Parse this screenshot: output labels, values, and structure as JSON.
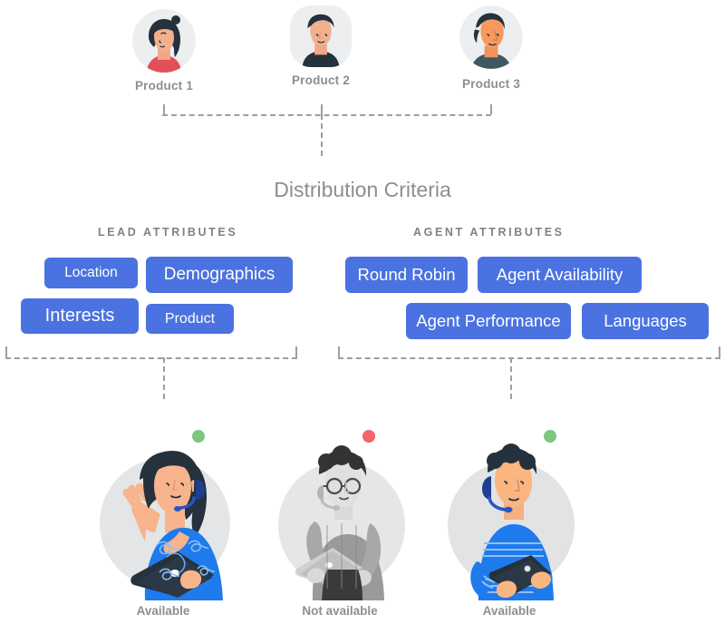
{
  "diagram": {
    "title": "Distribution Criteria",
    "products": [
      {
        "label": "Product 1",
        "avatar": "avatar-woman-red-top"
      },
      {
        "label": "Product 2",
        "avatar": "avatar-man-dark-top"
      },
      {
        "label": "Product 3",
        "avatar": "avatar-man-teal-top"
      }
    ],
    "groups": [
      {
        "heading": "LEAD ATTRIBUTES",
        "chips": [
          {
            "label": "Location"
          },
          {
            "label": "Demographics"
          },
          {
            "label": "Interests"
          },
          {
            "label": "Product"
          }
        ]
      },
      {
        "heading": "AGENT ATTRIBUTES",
        "chips": [
          {
            "label": "Round Robin"
          },
          {
            "label": "Agent Availability"
          },
          {
            "label": "Agent Performance"
          },
          {
            "label": "Languages"
          }
        ]
      }
    ],
    "agents": [
      {
        "label": "Available",
        "status": "available",
        "status_color": "#7dc67f",
        "illustration": "agent-woman-laptop-waving"
      },
      {
        "label": "Not available",
        "status": "not-available",
        "status_color": "#f4646b",
        "illustration": "agent-man-laptop-grayscale"
      },
      {
        "label": "Available",
        "status": "available",
        "status_color": "#7dc67f",
        "illustration": "agent-man-tablet"
      }
    ],
    "colors": {
      "chip_background": "#4a72e0",
      "chip_text": "#ffffff",
      "muted_text": "#8a8f94",
      "connector": "#9aa0a6",
      "available": "#7dc67f",
      "not_available": "#f4646b"
    }
  }
}
